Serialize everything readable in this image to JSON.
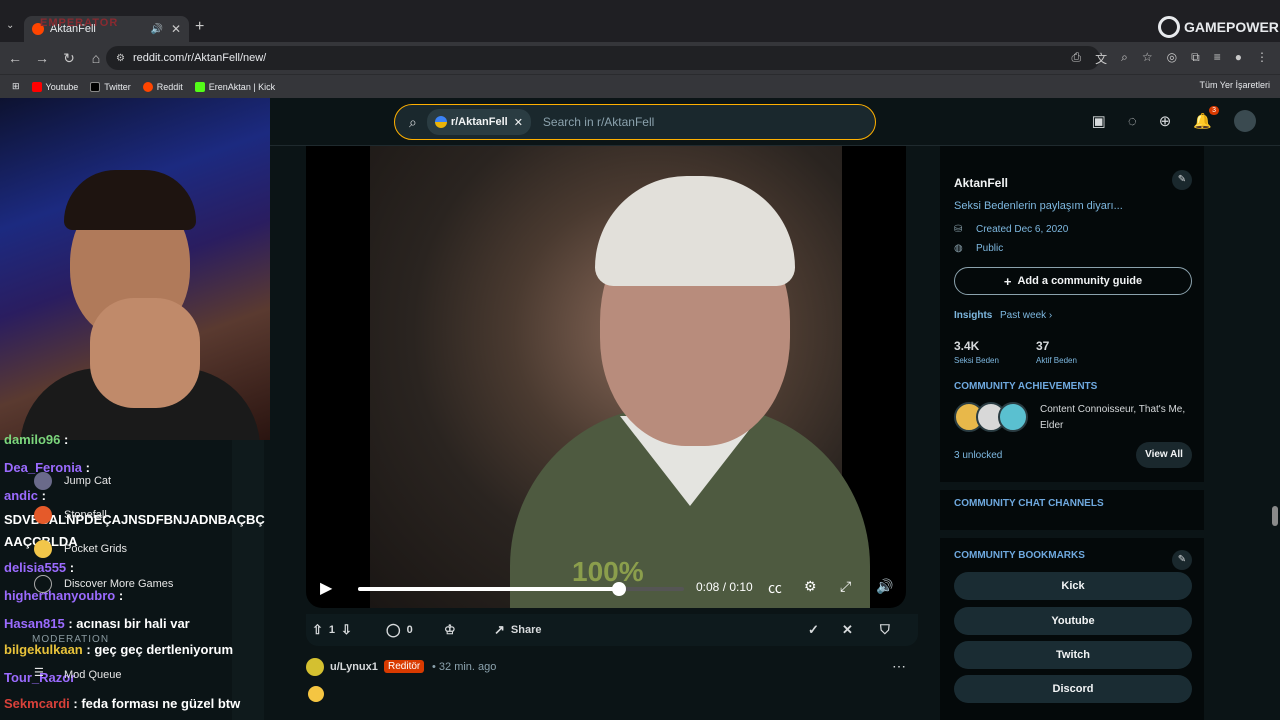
{
  "browser": {
    "tab_title": "AktanFell",
    "overlay_name": "EMPERATOR",
    "url": "reddit.com/r/AktanFell/new/",
    "bookmarks": [
      "Youtube",
      "Twitter",
      "Reddit",
      "ErenAktan | Kick"
    ],
    "bookmarks_all": "Tüm Yer İşaretleri",
    "logo_overlay": "GAMEPOWER"
  },
  "header": {
    "subreddit_chip": "r/AktanFell",
    "search_placeholder": "Search in r/AktanFell",
    "notification_count": "3"
  },
  "chat": [
    {
      "user": "damilo96",
      "text": ""
    },
    {
      "user": "Dea_Feronia",
      "text": ""
    },
    {
      "user": "andic",
      "text": ""
    },
    {
      "user": "",
      "text": "SDVBSALNPDEÇAJNSDFBNJADNBAÇBÇ"
    },
    {
      "user": "",
      "text": "AAÇCBLDA"
    },
    {
      "user": "delisia555",
      "text": ""
    },
    {
      "user": "higherthanyoubro",
      "text": ""
    },
    {
      "user": "Hasan815",
      "text": "acınası bir hali var"
    },
    {
      "user": "bilgekulkaan",
      "text": "geç geç dertleniyorum"
    },
    {
      "user": "Tour_Razor",
      "text": ""
    },
    {
      "user": "Sekmcardi",
      "text": "feda forması ne güzel btw"
    }
  ],
  "game_menu": {
    "items": [
      "Jump Cat",
      "Stonefall",
      "Pocket Grids",
      "Discover More Games"
    ],
    "moderation_label": "MODERATION",
    "mod_queue": "Mod Queue"
  },
  "video": {
    "watermark": "100%",
    "current_time": "0:08",
    "duration": "0:10",
    "time_display": "0:08 / 0:10",
    "progress": 0.8
  },
  "actions": {
    "upvotes": "1",
    "comments": "0",
    "share": "Share"
  },
  "comment": {
    "user": "u/Lynux1",
    "flair": "Reditör",
    "time": "• 32 min. ago"
  },
  "sidebar": {
    "title": "AktanFell",
    "description": "Seksi Bedenlerin paylaşım diyarı...",
    "created": "Created Dec 6, 2020",
    "visibility": "Public",
    "guide_button": "Add a community guide",
    "insights_label": "Insights",
    "insights_period": "Past week ›",
    "stats": [
      {
        "value": "3.4K",
        "label": "Seksi Beden"
      },
      {
        "value": "37",
        "label": "Aktif Beden"
      }
    ],
    "achievements_heading": "COMMUNITY ACHIEVEMENTS",
    "achievements_text": "Content Connoisseur, That's Me, Elder",
    "unlocked": "3 unlocked",
    "view_all": "View All",
    "chat_channels_heading": "COMMUNITY CHAT CHANNELS",
    "bookmarks_heading": "COMMUNITY BOOKMARKS",
    "bookmark_buttons": [
      "Kick",
      "Youtube",
      "Twitch",
      "Discord"
    ]
  },
  "colors": {
    "accent": "#ffb000",
    "flair": "#d93a00",
    "link": "#7eb8e0"
  }
}
